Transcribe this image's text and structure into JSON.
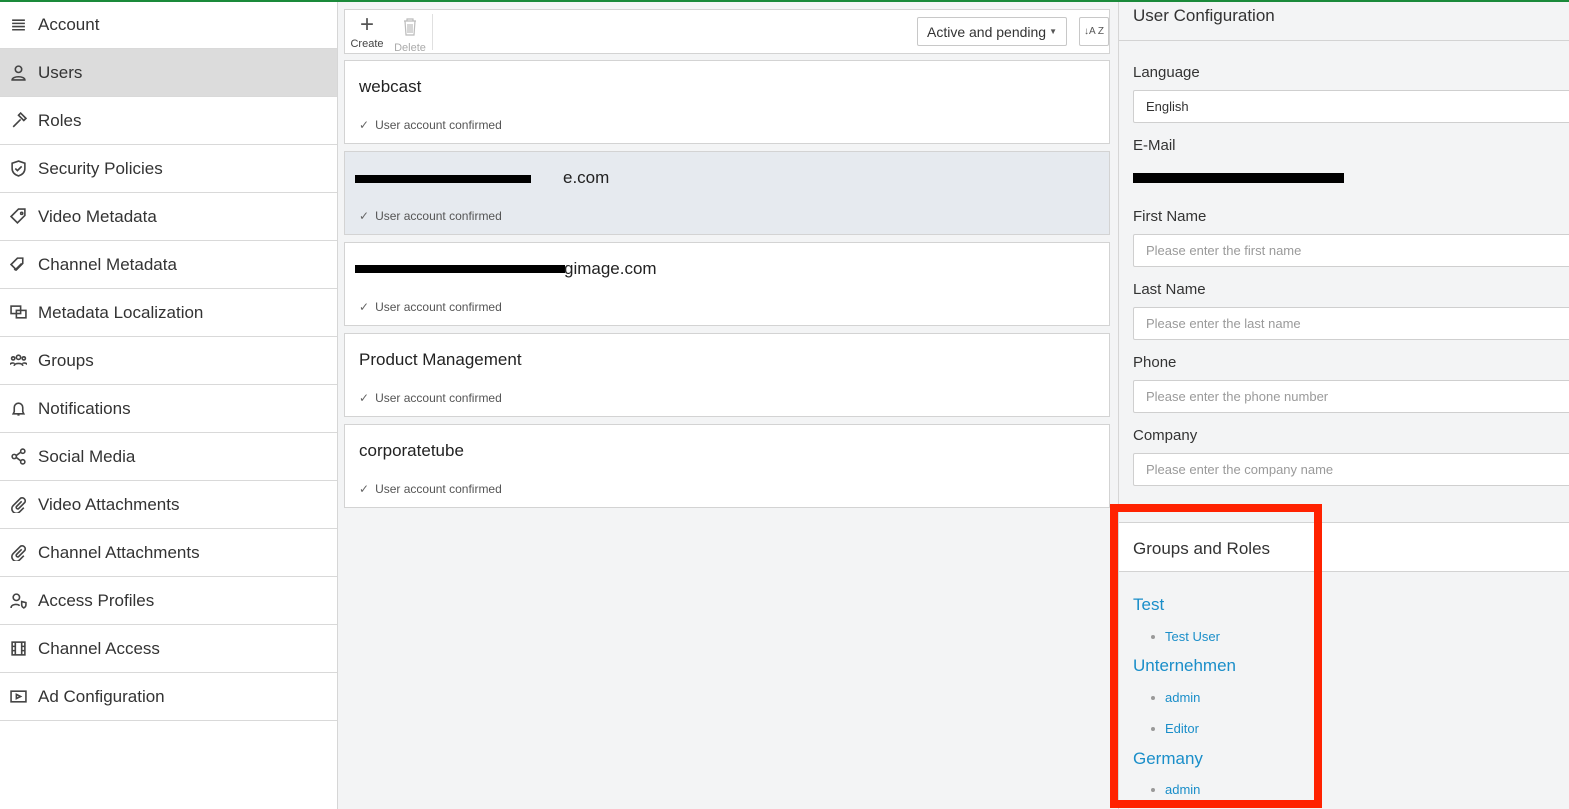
{
  "sidebar": {
    "items": [
      {
        "label": "Account",
        "icon": "list-icon"
      },
      {
        "label": "Users",
        "icon": "user-icon",
        "active": true
      },
      {
        "label": "Roles",
        "icon": "hammer-icon"
      },
      {
        "label": "Security Policies",
        "icon": "shield-icon"
      },
      {
        "label": "Video Metadata",
        "icon": "tag-icon"
      },
      {
        "label": "Channel Metadata",
        "icon": "tags-icon"
      },
      {
        "label": "Metadata Localization",
        "icon": "chat-icon"
      },
      {
        "label": "Groups",
        "icon": "users-icon"
      },
      {
        "label": "Notifications",
        "icon": "bell-icon"
      },
      {
        "label": "Social Media",
        "icon": "share-icon"
      },
      {
        "label": "Video Attachments",
        "icon": "paperclip-icon"
      },
      {
        "label": "Channel Attachments",
        "icon": "paperclip-icon"
      },
      {
        "label": "Access Profiles",
        "icon": "user-shield-icon"
      },
      {
        "label": "Channel Access",
        "icon": "film-icon"
      },
      {
        "label": "Ad Configuration",
        "icon": "tv-icon"
      }
    ]
  },
  "toolbar": {
    "create_label": "Create",
    "delete_label": "Delete",
    "filter_value": "Active and pending",
    "sort_label": "↓A Z"
  },
  "users": [
    {
      "name": "webcast",
      "status": "User account confirmed"
    },
    {
      "name": "e.com",
      "status": "User account confirmed",
      "selected": true
    },
    {
      "name": "gimage.com",
      "status": "User account confirmed"
    },
    {
      "name": "Product Management",
      "status": "User account confirmed"
    },
    {
      "name": "corporatetube",
      "status": "User account confirmed"
    }
  ],
  "config": {
    "title": "User Configuration",
    "language_label": "Language",
    "language_value": "English",
    "email_label": "E-Mail",
    "first_name_label": "First Name",
    "first_name_placeholder": "Please enter the first name",
    "last_name_label": "Last Name",
    "last_name_placeholder": "Please enter the last name",
    "phone_label": "Phone",
    "phone_placeholder": "Please enter the phone number",
    "company_label": "Company",
    "company_placeholder": "Please enter the company name"
  },
  "groups_roles": {
    "title": "Groups and Roles",
    "groups": [
      {
        "name": "Test",
        "roles": [
          "Test User"
        ]
      },
      {
        "name": "Unternehmen",
        "roles": [
          "admin",
          "Editor"
        ]
      },
      {
        "name": "Germany",
        "roles": [
          "admin"
        ]
      }
    ]
  },
  "colors": {
    "accent": "#1a8ec9",
    "highlight": "#ff2200",
    "top_bar": "#1a8a3a"
  }
}
